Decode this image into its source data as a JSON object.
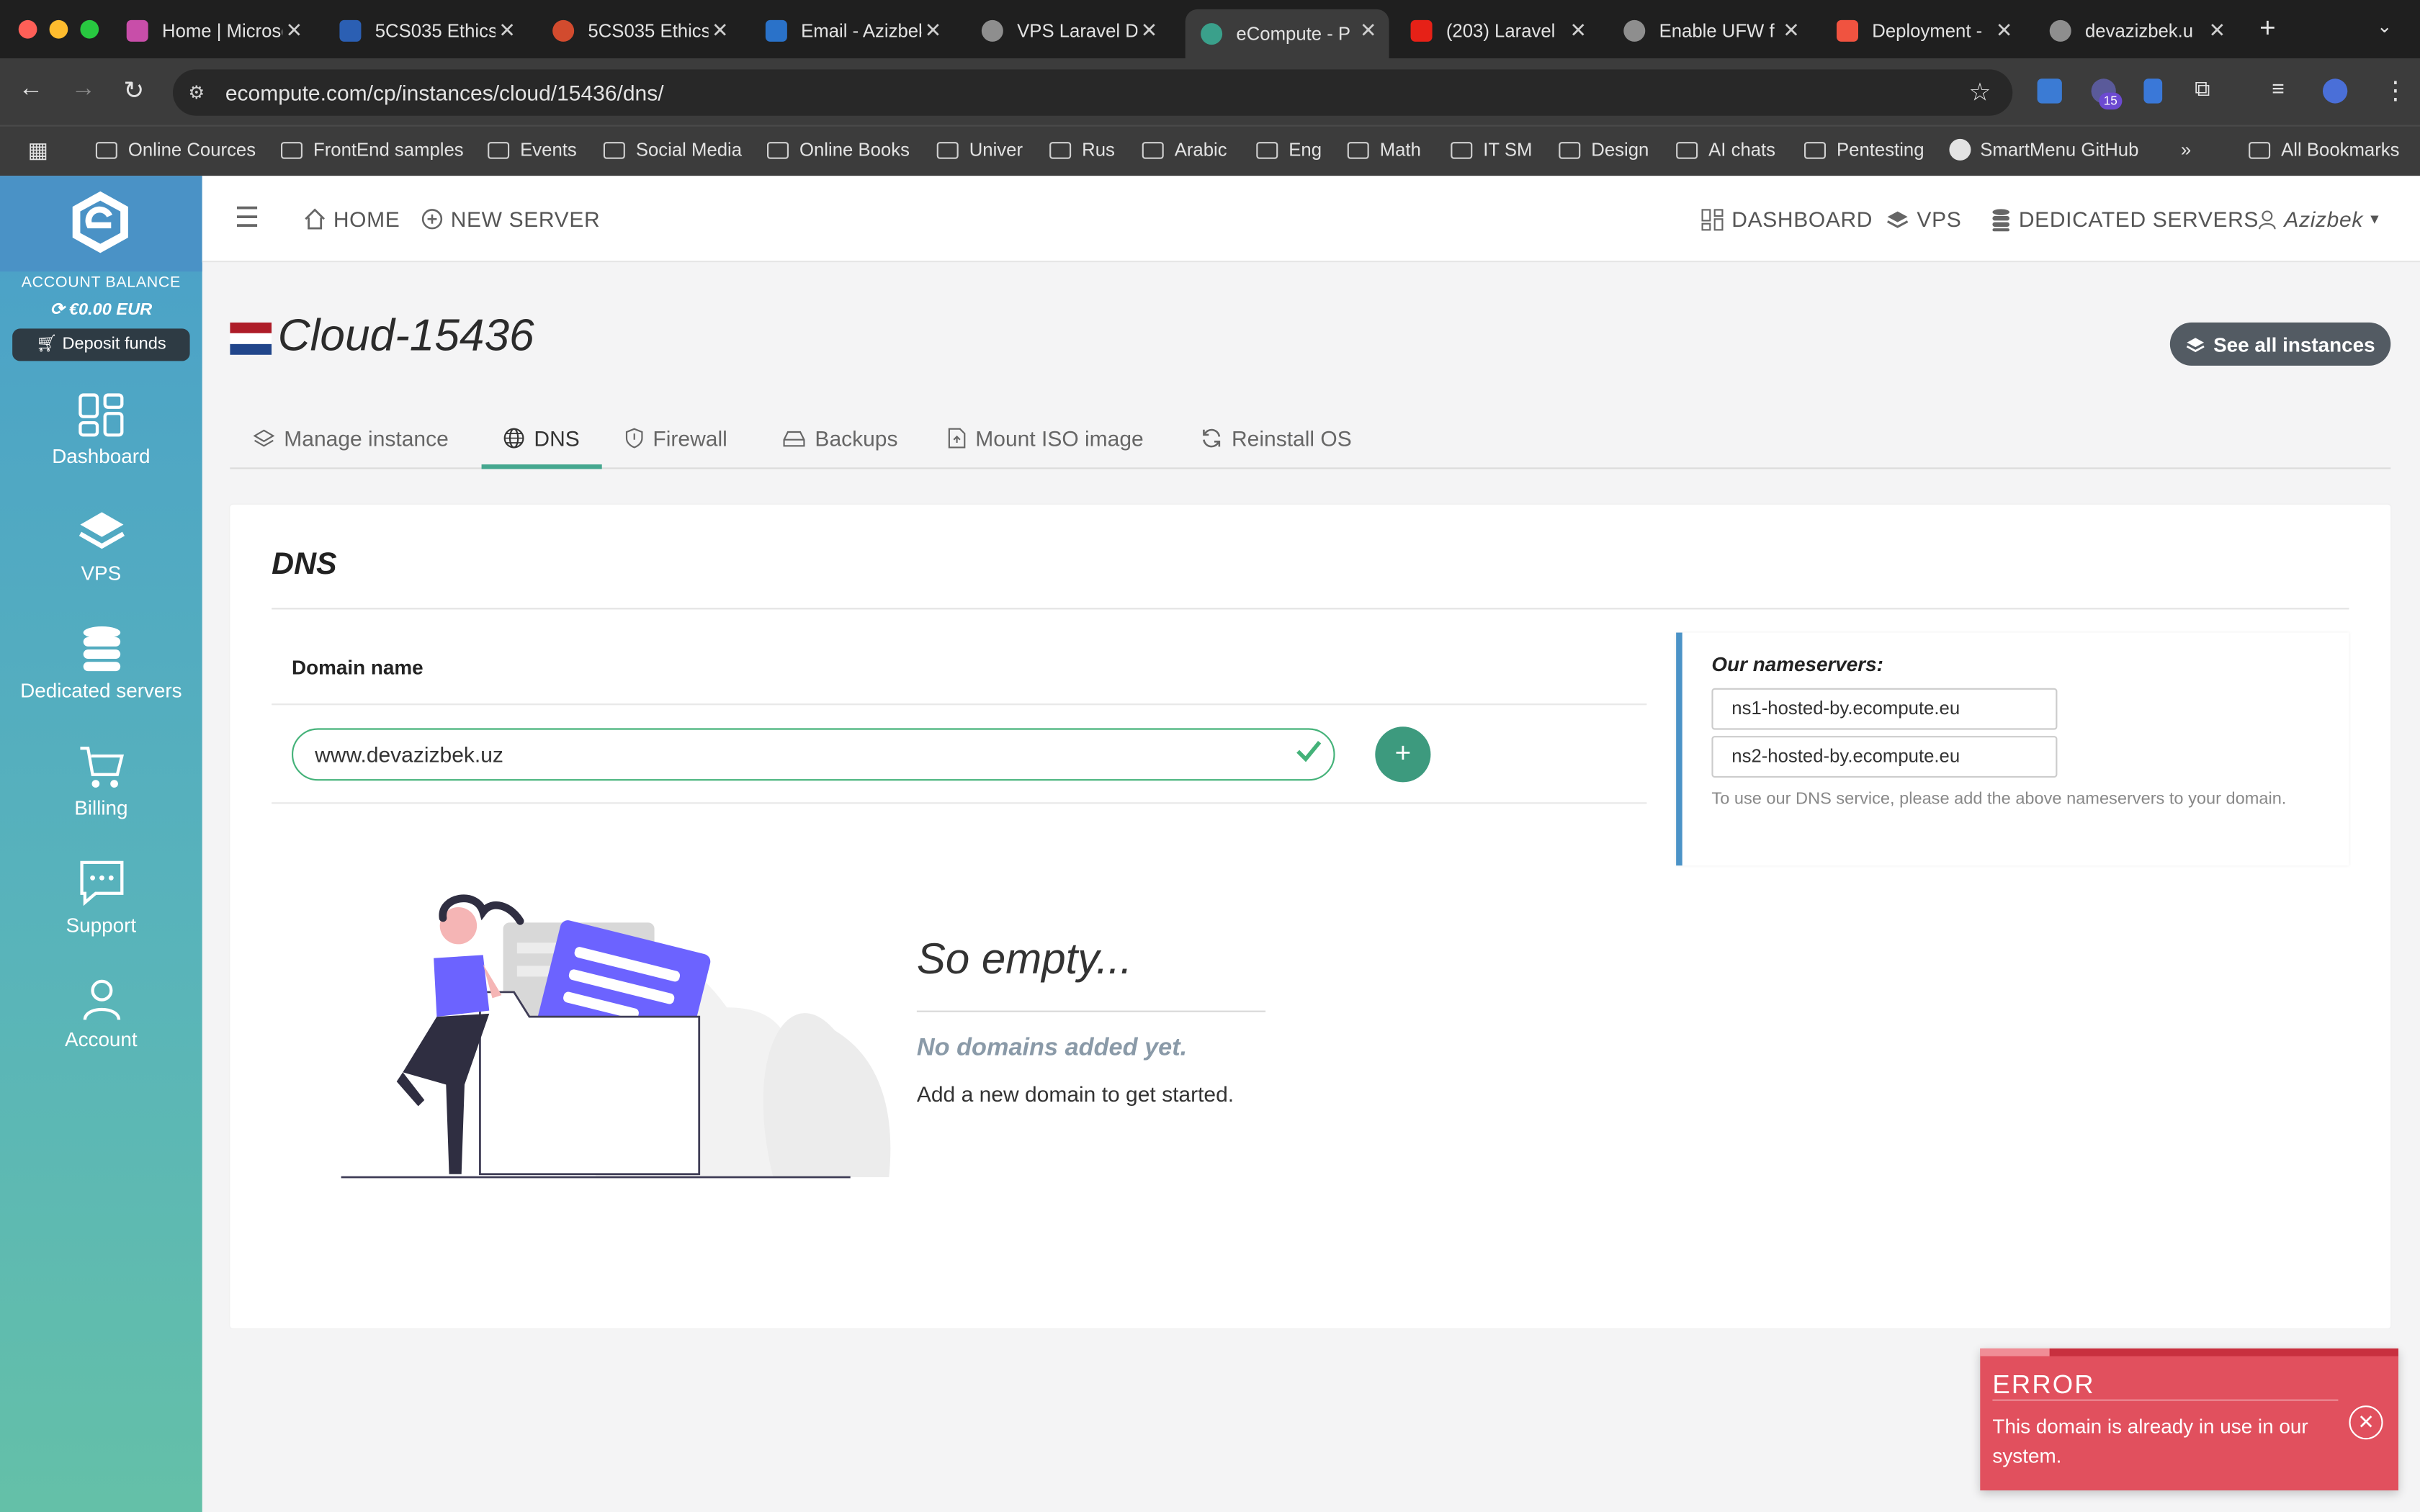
{
  "browser": {
    "tabs": [
      {
        "label": "Home | Microsoft",
        "color": "#c84ea9"
      },
      {
        "label": "5CS035 Ethics",
        "color": "#2b5fb3"
      },
      {
        "label": "5CS035 Ethics",
        "color": "#d24b2e"
      },
      {
        "label": "Email - Azizbek",
        "color": "#2a72c9"
      },
      {
        "label": "VPS Laravel D",
        "color": "#8e8e8e"
      },
      {
        "label": "eCompute - P",
        "color": "#3aa08b"
      },
      {
        "label": "(203) Laravel",
        "color": "#e62117"
      },
      {
        "label": "Enable UFW f",
        "color": "#8e8e8e"
      },
      {
        "label": "Deployment -",
        "color": "#f05340"
      },
      {
        "label": "devazizbek.u",
        "color": "#8e8e8e"
      }
    ],
    "url": "ecompute.com/cp/instances/cloud/15436/dns/",
    "extension_badge": "15",
    "bookmarks": [
      "Online Cources",
      "FrontEnd samples",
      "Events",
      "Social Media",
      "Online Books",
      "Univer",
      "Rus",
      "Arabic",
      "Eng",
      "Math",
      "IT SM",
      "Design",
      "AI chats",
      "Pentesting",
      "SmartMenu GitHub"
    ],
    "all_bookmarks": "All Bookmarks"
  },
  "sidebar": {
    "balance_label": "ACCOUNT BALANCE",
    "balance_value": "€0.00 EUR",
    "deposit_label": "Deposit funds",
    "items": [
      {
        "label": "Dashboard",
        "icon": "dashboard-icon"
      },
      {
        "label": "VPS",
        "icon": "layers-icon"
      },
      {
        "label": "Dedicated servers",
        "icon": "database-icon"
      },
      {
        "label": "Billing",
        "icon": "cart-icon"
      },
      {
        "label": "Support",
        "icon": "chat-icon"
      },
      {
        "label": "Account",
        "icon": "user-icon"
      }
    ]
  },
  "topbar": {
    "home": "HOME",
    "new_server": "NEW SERVER",
    "dashboard": "DASHBOARD",
    "vps": "VPS",
    "dedicated": "DEDICATED SERVERS",
    "user": "Azizbek"
  },
  "page": {
    "title": "Cloud-15436",
    "see_all": "See all instances",
    "tabs": [
      "Manage instance",
      "DNS",
      "Firewall",
      "Backups",
      "Mount ISO image",
      "Reinstall OS"
    ],
    "active_tab": "DNS"
  },
  "dns": {
    "card_title": "DNS",
    "column_header": "Domain name",
    "domain_value": "www.devazizbek.uz",
    "add_label": "+",
    "nameservers_title": "Our nameservers:",
    "nameservers": [
      "ns1-hosted-by.ecompute.eu",
      "ns2-hosted-by.ecompute.eu"
    ],
    "nameservers_note": "To use our DNS service, please add the above nameservers to your domain.",
    "empty_title": "So empty...",
    "empty_subtitle": "No domains added yet.",
    "empty_desc": "Add a new domain to get started."
  },
  "toast": {
    "title": "ERROR",
    "message": "This domain is already in use in our system.",
    "color": "#e1505e"
  },
  "colors": {
    "accent": "#3d9a7e",
    "sidebar_top": "#4aa0c9",
    "sidebar_bottom": "#64c0a8"
  }
}
